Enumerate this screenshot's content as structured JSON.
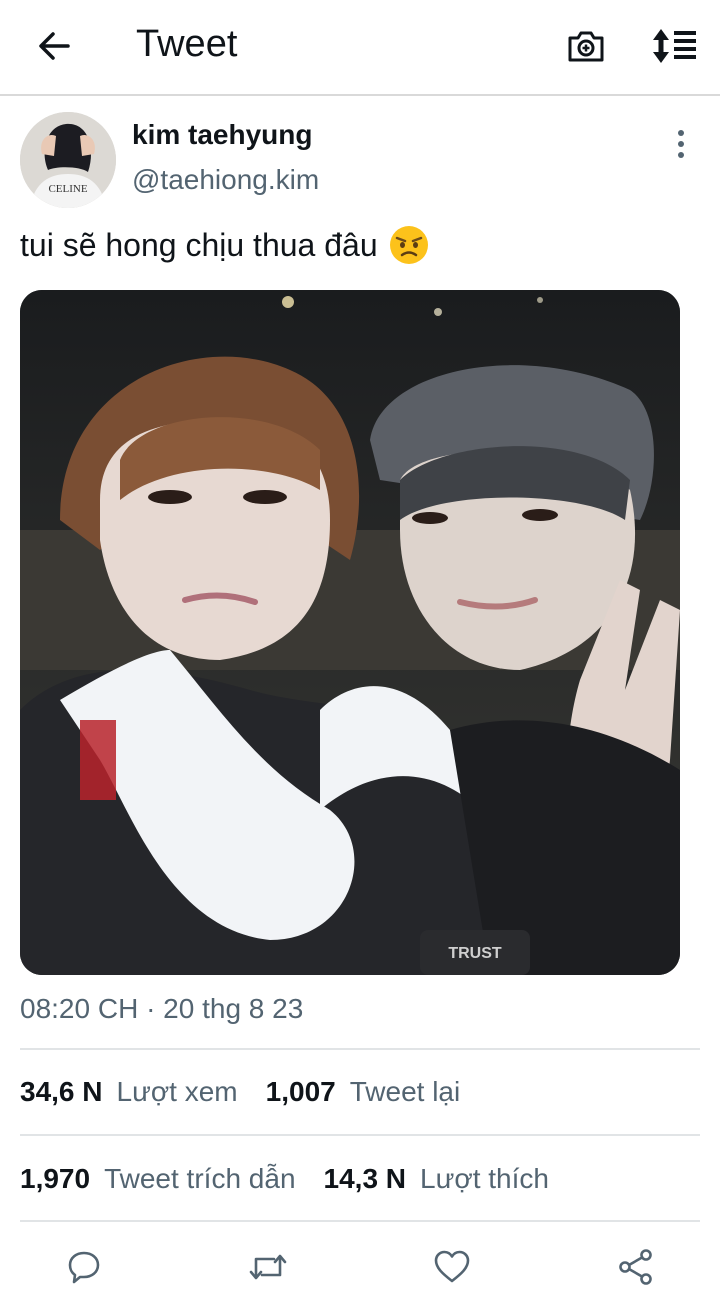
{
  "header": {
    "title": "Tweet",
    "back_icon": "arrow-left-icon",
    "camera_icon": "camera-icon",
    "sort_icon": "sort-icon"
  },
  "tweet": {
    "author_name": "kim taehyung",
    "author_handle": "@taehiong.kim",
    "text": "tui sẽ hong chịu thua đâu",
    "emoji": "angry-face-emoji",
    "avatar_print": "CELINE",
    "photo_jacket_print": "TRUST",
    "timestamp": "08:20 CH · 20 thg 8 23"
  },
  "stats": {
    "views_count": "34,6 N",
    "views_label": "Lượt xem",
    "retweets_count": "1,007",
    "retweets_label": "Tweet lại",
    "quotes_count": "1,970",
    "quotes_label": "Tweet trích dẫn",
    "likes_count": "14,3 N",
    "likes_label": "Lượt thích"
  },
  "actions": {
    "reply_icon": "reply-icon",
    "retweet_icon": "retweet-icon",
    "like_icon": "heart-icon",
    "share_icon": "share-icon"
  },
  "colors": {
    "text_primary": "#0f1419",
    "text_secondary": "#536471",
    "divider": "#e1e4e6"
  }
}
